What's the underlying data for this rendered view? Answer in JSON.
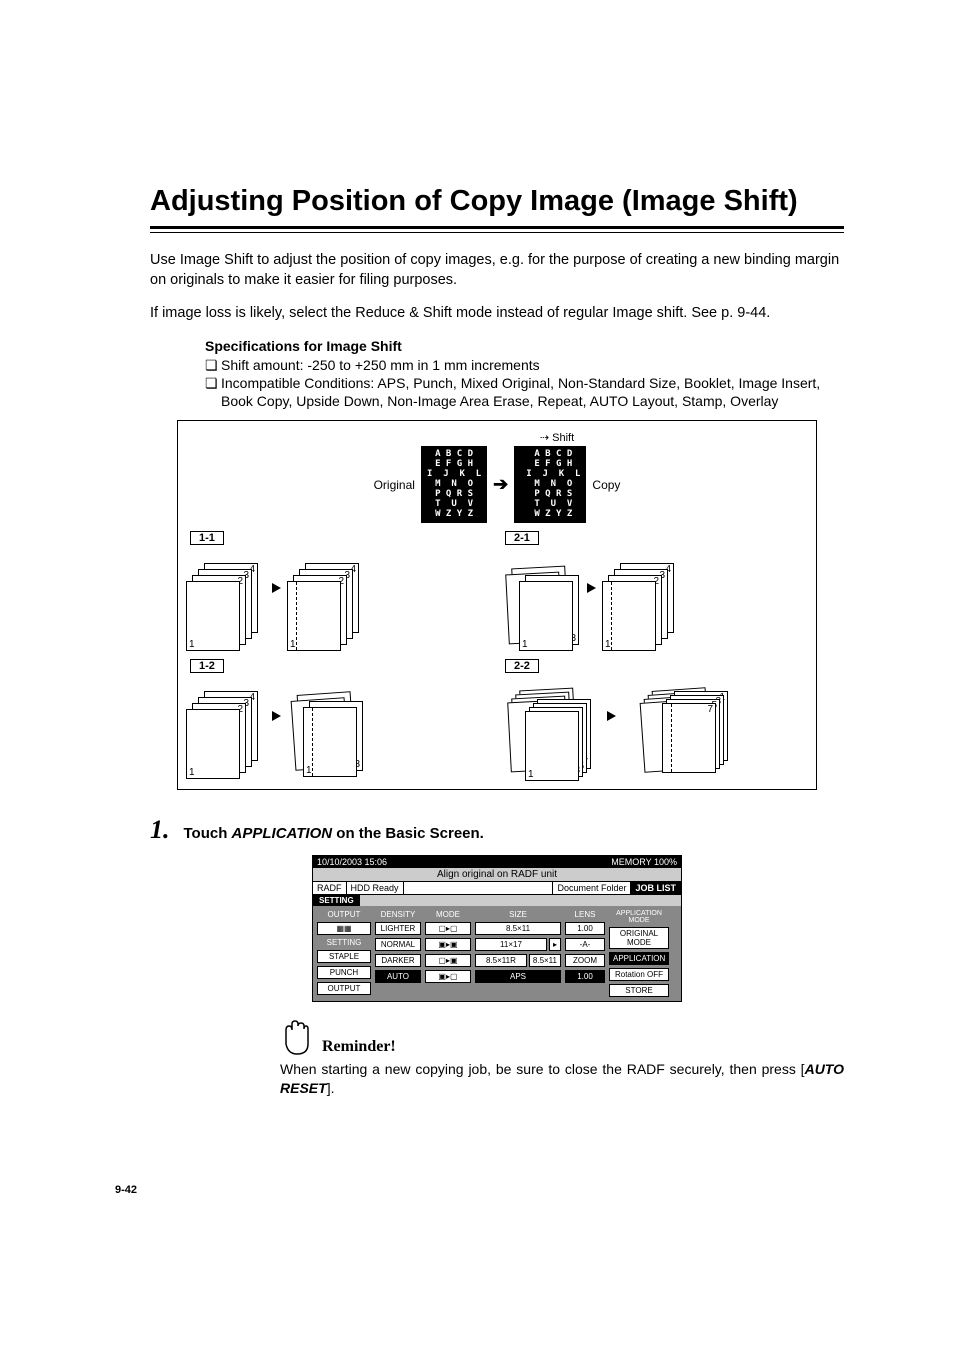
{
  "title": "Adjusting Position of Copy Image (Image Shift)",
  "para1": "Use Image Shift to adjust the position of copy images, e.g. for the purpose of creating a new binding margin on originals to make it easier for filing purposes.",
  "para2": "If image loss is likely, select the Reduce & Shift mode instead of regular Image shift. See p. 9-44.",
  "spec": {
    "heading": "Specifications for Image Shift",
    "items": [
      "Shift amount: -250 to +250 mm in 1 mm increments",
      "Incompatible Conditions: APS, Punch, Mixed Original, Non-Standard Size, Booklet, Image Insert, Book Copy, Upside Down, Non-Image Area Erase, Repeat, AUTO Layout, Stamp, Overlay"
    ],
    "marker": "❏"
  },
  "diagram": {
    "shift_label": "Shift",
    "original_label": "Original",
    "copy_label": "Copy",
    "letters": "A B C D\nE F G H\nI  J  K  L\nM  N  O\nP Q R S\nT  U  V\nW Z Y Z",
    "panels": [
      "1-1",
      "2-1",
      "1-2",
      "2-2"
    ]
  },
  "step": {
    "num": "1.",
    "prefix": "Touch ",
    "key": "APPLICATION",
    "suffix": " on the Basic Screen."
  },
  "screen": {
    "datetime": "10/10/2003 15:06",
    "message": "Align original on RADF unit",
    "memory": "MEMORY 100%",
    "radf": "RADF",
    "hdd": "HDD Ready",
    "setting_tab": "SETTING",
    "doc_folder": "Document Folder",
    "job_list": "JOB LIST",
    "headers": {
      "output": "OUTPUT",
      "density": "DENSITY",
      "mode": "MODE",
      "size": "SIZE",
      "lens": "LENS",
      "app": "APPLICATION MODE"
    },
    "setting_label": "SETTING",
    "buttons": {
      "lighter": "LIGHTER",
      "normal": "NORMAL",
      "darker": "DARKER",
      "staple": "STAPLE",
      "punch": "PUNCH",
      "output": "OUTPUT",
      "auto": "AUTO",
      "aps": "APS",
      "size1": "8.5×11",
      "size2": "11×17",
      "size3": "8.5×11R",
      "size4": "8.5×11",
      "lens_val": "1.00",
      "lens_auto": "-A-",
      "zoom": "ZOOM",
      "lens_one": "1.00",
      "orig": "ORIGINAL MODE",
      "application": "APPLICATION",
      "rotoff": "Rotation OFF",
      "store": "STORE"
    }
  },
  "reminder": {
    "label": "Reminder!",
    "text_before": "When starting a new copying job, be sure to close the RADF securely, then press [",
    "key": "AUTO RESET",
    "text_after": "]."
  },
  "page_number": "9-42"
}
